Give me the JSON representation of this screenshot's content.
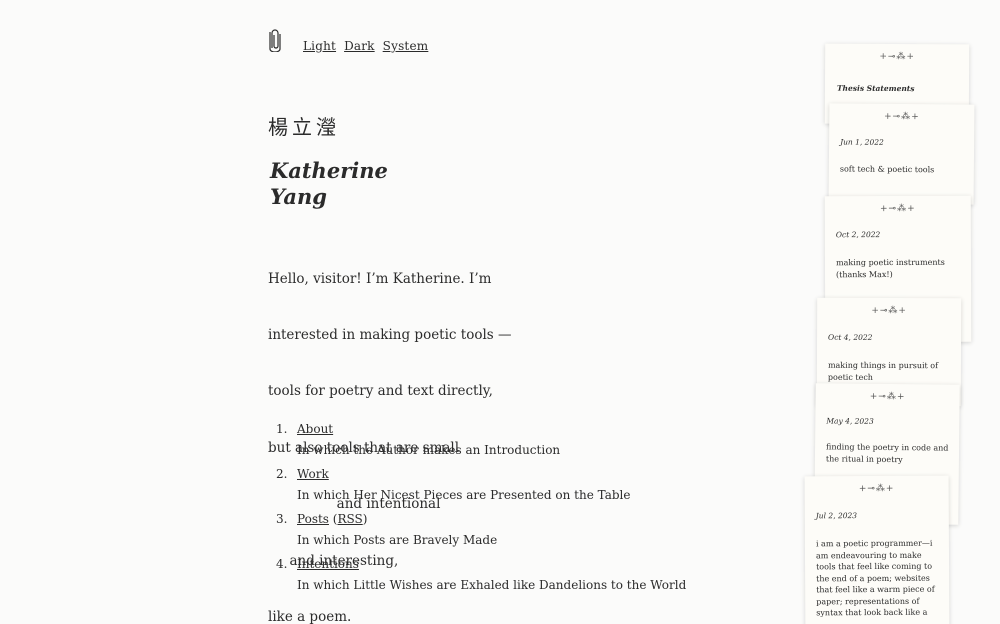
{
  "header": {
    "logo_icon": "paperclip-icon",
    "theme_links": [
      "Light",
      "Dark",
      "System"
    ]
  },
  "name": {
    "cjk": "楊立瀅",
    "first": "Katherine",
    "last": "Yang"
  },
  "intro": {
    "lines": [
      "Hello, visitor! I’m Katherine. I’m",
      "interested in making poetic tools —",
      "tools for poetry and text directly,",
      "but also tools that are small",
      "                and intentional",
      "     and interesting,",
      "like a poem."
    ]
  },
  "toc": [
    {
      "num": "1.",
      "link": "About",
      "desc": "In which the Author makes an Introduction"
    },
    {
      "num": "2.",
      "link": "Work",
      "desc": "In which Her Nicest Pieces are Presented on the Table"
    },
    {
      "num": "3.",
      "link": "Posts",
      "extra_open": " (",
      "extra_link": "RSS",
      "extra_close": ")",
      "desc": "In which Posts are Bravely Made"
    },
    {
      "num": "4.",
      "link": "Intentions",
      "desc": "In which Little Wishes are Exhaled like Dandelions to the World"
    }
  ],
  "cards": {
    "ornament": "+⊸⁂+",
    "heading": "Thesis Statements",
    "items": [
      {
        "date": "Jun 1, 2022",
        "text": "soft tech & poetic tools"
      },
      {
        "date": "Oct 2, 2022",
        "text": "making poetic instruments (thanks Max!)"
      },
      {
        "date": "Oct 4, 2022",
        "text": "making things in pursuit of poetic tech"
      },
      {
        "date": "May 4, 2023",
        "text": "finding the poetry in code and the ritual in poetry"
      },
      {
        "date": "Jul 2, 2023",
        "text": "i am a poetic programmer—i am endeavouring to make tools that feel like coming to the end of a poem; websites that feel like a warm piece of paper; representations of syntax that look back like a"
      }
    ]
  }
}
